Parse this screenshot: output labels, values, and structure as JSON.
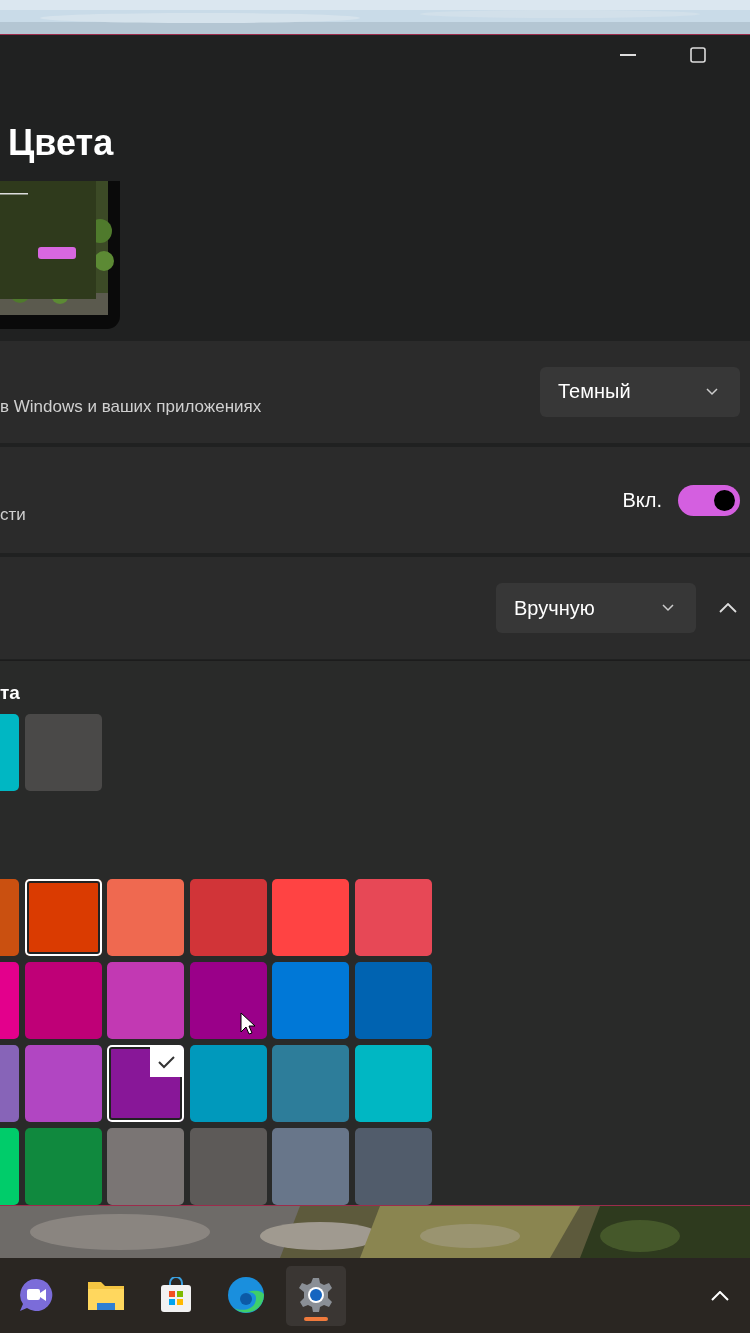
{
  "page": {
    "title": "Цвета"
  },
  "mode_card": {
    "description": "в Windows и ваших приложениях",
    "dropdown": "Темный"
  },
  "transparency_card": {
    "description": "сти",
    "state_label": "Вкл.",
    "on": true
  },
  "accent_card": {
    "dropdown": "Вручную",
    "expanded": true
  },
  "custom_colors": {
    "label": "та",
    "swatches": [
      {
        "color": "#00b7c3",
        "selected": false,
        "focused": false
      },
      {
        "color": "#4a4948",
        "selected": false,
        "focused": false
      }
    ]
  },
  "windows_colors": {
    "swatches": [
      {
        "color": "#ca5010",
        "selected": false,
        "focused": false
      },
      {
        "color": "#da3b01",
        "selected": false,
        "focused": true
      },
      {
        "color": "#ef6950",
        "selected": false,
        "focused": false
      },
      {
        "color": "#d13438",
        "selected": false,
        "focused": false
      },
      {
        "color": "#ff4343",
        "selected": false,
        "focused": false
      },
      {
        "color": "#e74856",
        "selected": false,
        "focused": false
      },
      {
        "color": "#e3008c",
        "selected": false,
        "focused": false
      },
      {
        "color": "#bf0077",
        "selected": false,
        "focused": false
      },
      {
        "color": "#c239b3",
        "selected": false,
        "focused": false
      },
      {
        "color": "#9a0089",
        "selected": false,
        "focused": false
      },
      {
        "color": "#0078d7",
        "selected": false,
        "focused": false
      },
      {
        "color": "#0063b1",
        "selected": false,
        "focused": false
      },
      {
        "color": "#8764b8",
        "selected": false,
        "focused": false
      },
      {
        "color": "#b146c2",
        "selected": false,
        "focused": false
      },
      {
        "color": "#881798",
        "selected": true,
        "focused": false
      },
      {
        "color": "#0099bc",
        "selected": false,
        "focused": false
      },
      {
        "color": "#2d7d9a",
        "selected": false,
        "focused": false
      },
      {
        "color": "#00b7c3",
        "selected": false,
        "focused": false
      },
      {
        "color": "#00cc6a",
        "selected": false,
        "focused": false
      },
      {
        "color": "#10893e",
        "selected": false,
        "focused": false
      },
      {
        "color": "#7a7574",
        "selected": false,
        "focused": false
      },
      {
        "color": "#5d5a58",
        "selected": false,
        "focused": false
      },
      {
        "color": "#68768a",
        "selected": false,
        "focused": false
      },
      {
        "color": "#515c6b",
        "selected": false,
        "focused": false
      }
    ]
  },
  "taskbar": {
    "apps": [
      {
        "kind": "chat",
        "selected": false
      },
      {
        "kind": "folder",
        "selected": false
      },
      {
        "kind": "store",
        "selected": false
      },
      {
        "kind": "browser",
        "selected": false
      },
      {
        "kind": "settings",
        "selected": true
      }
    ]
  }
}
